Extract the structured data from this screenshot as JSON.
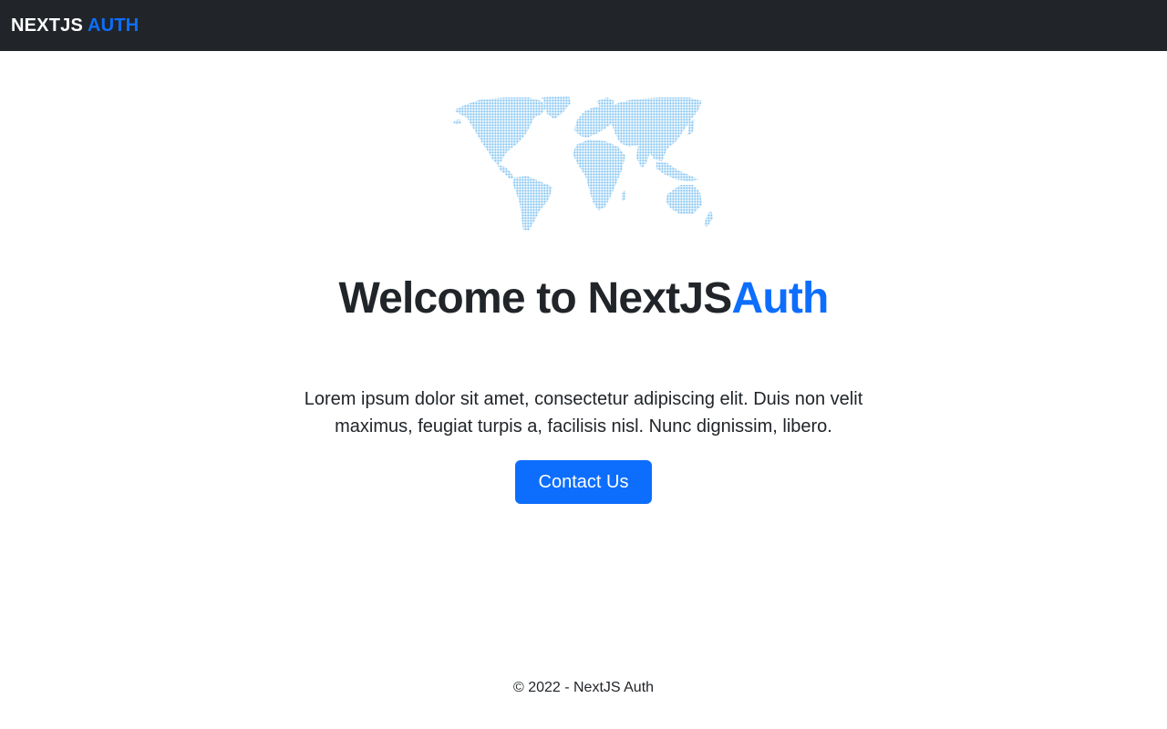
{
  "navbar": {
    "brand_primary": "NEXTJS",
    "brand_accent": "AUTH"
  },
  "hero": {
    "illustration_icon": "world-map-dots-icon",
    "title_primary": "Welcome to NextJS",
    "title_accent": "Auth",
    "lead": "Lorem ipsum dolor sit amet, consectetur adipiscing elit. Duis non velit maximus, feugiat turpis a, facilisis nisl. Nunc dignissim, libero.",
    "cta_label": "Contact Us"
  },
  "footer": {
    "text": "© 2022 - NextJS Auth"
  },
  "colors": {
    "navbar_bg": "#212529",
    "accent": "#0d6efd",
    "map_dots": "#7cc0f0",
    "text": "#212529"
  }
}
